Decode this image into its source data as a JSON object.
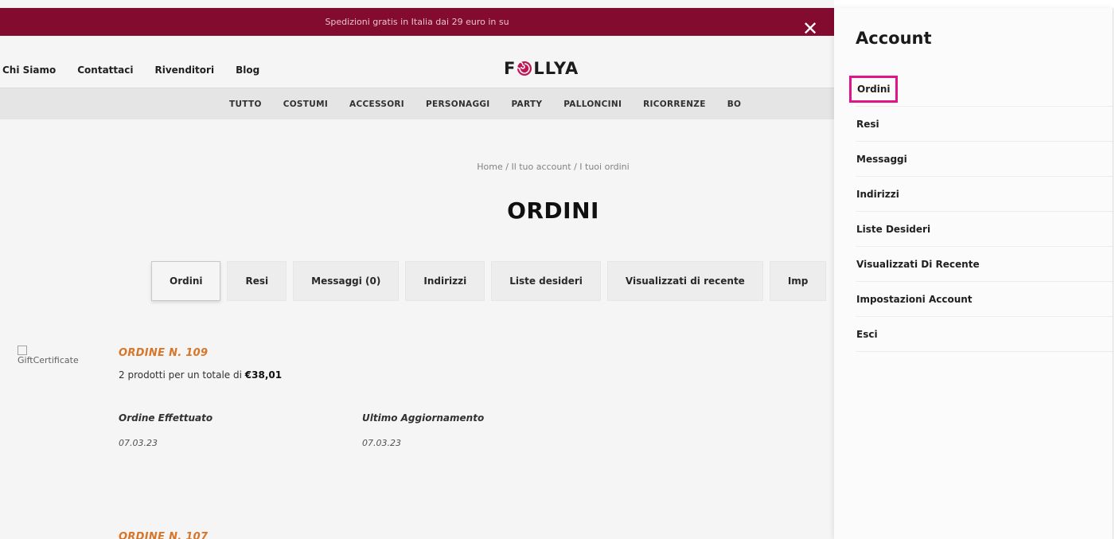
{
  "promo": {
    "text": "Spedizioni gratis in Italia dai 29 euro in su"
  },
  "top_nav": [
    "Chi Siamo",
    "Contattaci",
    "Rivenditori",
    "Blog"
  ],
  "logo": {
    "left": "F",
    "right": "LLYA"
  },
  "categories": [
    "TUTTO",
    "COSTUMI",
    "ACCESSORI",
    "PERSONAGGI",
    "PARTY",
    "PALLONCINI",
    "RICORRENZE",
    "BO"
  ],
  "breadcrumb": "Home / Il tuo account / I tuoi ordini",
  "page_title": "ORDINI",
  "tabs": [
    "Ordini",
    "Resi",
    "Messaggi (0)",
    "Indirizzi",
    "Liste desideri",
    "Visualizzati di recente",
    "Imp"
  ],
  "gift_alt": "GiftCertificate",
  "orders": [
    {
      "title": "ORDINE N. 109",
      "summary_prefix": "2 prodotti per un totale di ",
      "total": "€38,01",
      "placed_label": "Ordine Effettuato",
      "placed_date": "07.03.23",
      "updated_label": "Ultimo Aggiornamento",
      "updated_date": "07.03.23"
    },
    {
      "title": "ORDINE N. 107"
    }
  ],
  "panel": {
    "title": "Account",
    "items": [
      "Ordini",
      "Resi",
      "Messaggi",
      "Indirizzi",
      "Liste Desideri",
      "Visualizzati Di Recente",
      "Impostazioni Account",
      "Esci"
    ],
    "highlight_color": "#e0158a"
  },
  "colors": {
    "promo_bg": "#8a0c32",
    "order_title": "#e07a2b"
  },
  "icons": {
    "close": "close-icon",
    "logo_swirl": "swirl-logo-icon"
  }
}
